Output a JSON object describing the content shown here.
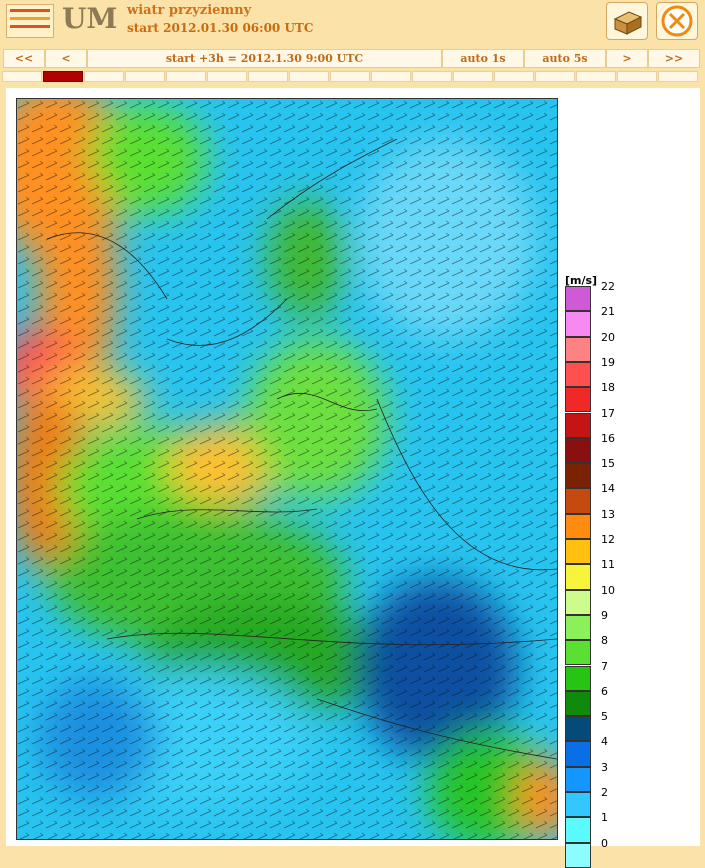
{
  "app": {
    "model": "UM",
    "title": "wiatr przyziemny",
    "start": "start 2012.01.30 06:00 UTC"
  },
  "nav": {
    "first": "<<",
    "prev": "<",
    "current": "start +3h  =  2012.1.30 9:00 UTC",
    "auto1": "auto 1s",
    "auto5": "auto 5s",
    "next": ">",
    "last": ">>"
  },
  "timeline": {
    "total_steps": 17,
    "active_index": 1
  },
  "legend": {
    "unit": "[m/s]",
    "levels": [
      "22",
      "21",
      "20",
      "19",
      "18",
      "17",
      "16",
      "15",
      "14",
      "13",
      "12",
      "11",
      "10",
      "9",
      "8",
      "7",
      "6",
      "5",
      "4",
      "3",
      "2",
      "1",
      "0"
    ],
    "colors": [
      "#d05ad6",
      "#f78af0",
      "#ff8282",
      "#ff5050",
      "#f02828",
      "#c41414",
      "#881010",
      "#7a2204",
      "#c44a10",
      "#ff8c10",
      "#ffc010",
      "#f7f43c",
      "#cdfc8c",
      "#8cf05a",
      "#5ae032",
      "#28c414",
      "#108a0a",
      "#064a7a",
      "#0a6ee6",
      "#1496ff",
      "#32c8ff",
      "#5afaff",
      "#8cfcff"
    ]
  }
}
